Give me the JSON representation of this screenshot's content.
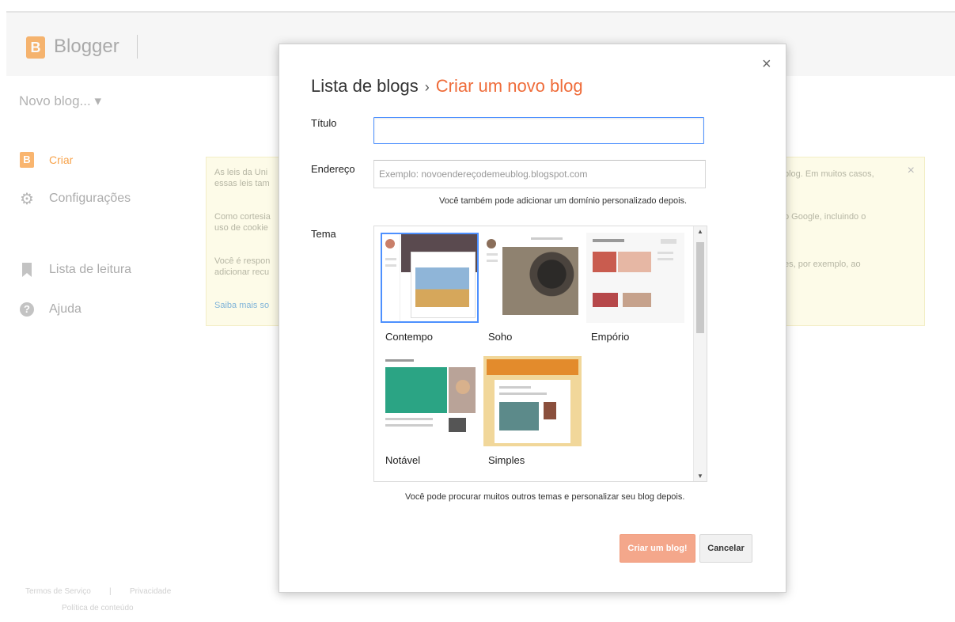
{
  "header": {
    "logo_letter": "B",
    "app_name": "Blogger"
  },
  "nav": {
    "new_blog": "Novo blog... ▾",
    "items": [
      {
        "label": "Criar",
        "icon": "blogger-icon"
      },
      {
        "label": "Configurações",
        "icon": "gear-icon"
      },
      {
        "label": "Lista de leitura",
        "icon": "bookmark-icon"
      },
      {
        "label": "Ajuda",
        "icon": "help-icon"
      }
    ]
  },
  "footer": {
    "terms": "Termos de Serviço",
    "privacy": "Privacidade",
    "content_policy": "Política de conteúdo"
  },
  "notice": {
    "p1_left": "As leis da Uni",
    "p1_left2": "essas leis tam",
    "p1_right": "blog. Em muitos casos,",
    "p2_left": "Como cortesia",
    "p2_left2": "uso de cookie",
    "p2_right": "o Google, incluindo o",
    "p3_left": "Você é respon",
    "p3_left2": "adicionar recu",
    "p3_right": "es, por exemplo, ao",
    "link": "Saiba mais so",
    "close": "×"
  },
  "dialog": {
    "close": "×",
    "breadcrumb_parent": "Lista de blogs",
    "breadcrumb_sep": "›",
    "breadcrumb_current": "Criar um novo blog",
    "title_label": "Título",
    "title_value": "",
    "address_label": "Endereço",
    "address_placeholder": "Exemplo: novoendereçodemeublog.blogspot.com",
    "address_hint": "Você também pode adicionar um domínio personalizado depois.",
    "theme_label": "Tema",
    "themes": [
      "Contempo",
      "Soho",
      "Empório",
      "Notável",
      "Simples"
    ],
    "selected_theme": "Contempo",
    "themes_hint": "Você pode procurar muitos outros temas e personalizar seu blog depois.",
    "create_button": "Criar um blog!",
    "cancel_button": "Cancelar"
  }
}
